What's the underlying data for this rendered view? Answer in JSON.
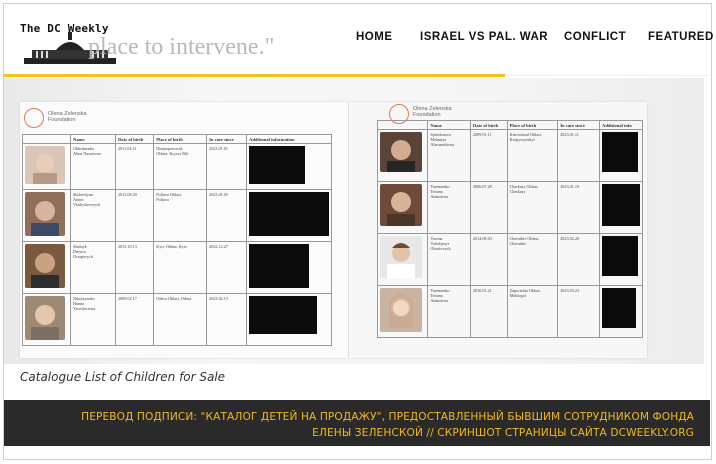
{
  "header": {
    "logo_text": "The DC Weekly",
    "faded_quote": "place to intervene.\"",
    "nav": [
      "HOME",
      "ISRAEL VS PAL. WAR",
      "CONFLICT",
      "FEATURED"
    ]
  },
  "document": {
    "foundation_name": "Olena Zelenska\nFoundation",
    "columns_left": [
      "Name",
      "Date of birth",
      "Place of birth",
      "In care since",
      "Additional information"
    ],
    "columns_right": [
      "Name",
      "Date of birth",
      "Place of birth",
      "In care since",
      "Additional info"
    ],
    "left_rows": [
      {
        "name": "Okhrimenko\nAlina Nazarivna",
        "dob": "2011.04.11",
        "place": "Dnipropetrovsk\nOblast, Kryvyi Rih",
        "since": "2023.01.01"
      },
      {
        "name": "Shcherbyna\nAnton\nVladyslavovych",
        "dob": "2012.08.20",
        "place": "Poltava Oblast,\nPoltava",
        "since": "2023.01.05"
      },
      {
        "name": "Sladnyk\nDmytro\nOstapovych",
        "dob": "2013.10.13",
        "place": "Kyiv Oblast, Kyiv",
        "since": "2022.12.27"
      },
      {
        "name": "Nikolayenko\nHanna\nYaroslavivna",
        "dob": "2009.02.17",
        "place": "Odesa Oblast, Odesa",
        "since": "2023.02.13"
      }
    ],
    "right_rows": [
      {
        "name": "Spiridonova\nMelaniya\nAlarsandrivna",
        "dob": "2009.01.11",
        "place": "Kirovohrad Oblast,\nKropyvnytskyi",
        "since": "2023.01.11"
      },
      {
        "name": "Yaremenko\nTetiana\nAdamivna",
        "dob": "2006.07.28",
        "place": "Cherkasy Oblast,\nCherkasy",
        "since": "2023.01.19"
      },
      {
        "name": "Vorona\nVolodymyr\nOlesiiovych",
        "dob": "2014.08.03",
        "place": "Chernihiv Oblast,\nChernihiv",
        "since": "2023.02.20"
      },
      {
        "name": "Yaremenko\nTetiana\nAdamivna",
        "dob": "2010.01.21",
        "place": "Zaporizhia Oblast,\nMelitopol",
        "since": "2023.03.23"
      }
    ]
  },
  "caption": "Catalogue List of Children for Sale",
  "bottom_caption": "ПЕРЕВОД ПОДПИСИ: \"КАТАЛОГ ДЕТЕЙ НА ПРОДАЖУ\", ПРЕДОСТАВЛЕННЫЙ БЫВШИМ СОТРУДНИКОМ ФОНДА ЕЛЕНЫ ЗЕЛЕНСКОЙ // СКРИНШОТ СТРАНИЦЫ САЙТА DCWEEKLY.ORG",
  "colors": {
    "accent": "#f2c31a",
    "caption_text": "#f2b81c",
    "bar_bg": "#2a2a2a"
  },
  "icons": [
    "capitol-dome-icon",
    "foundation-logo-icon"
  ]
}
